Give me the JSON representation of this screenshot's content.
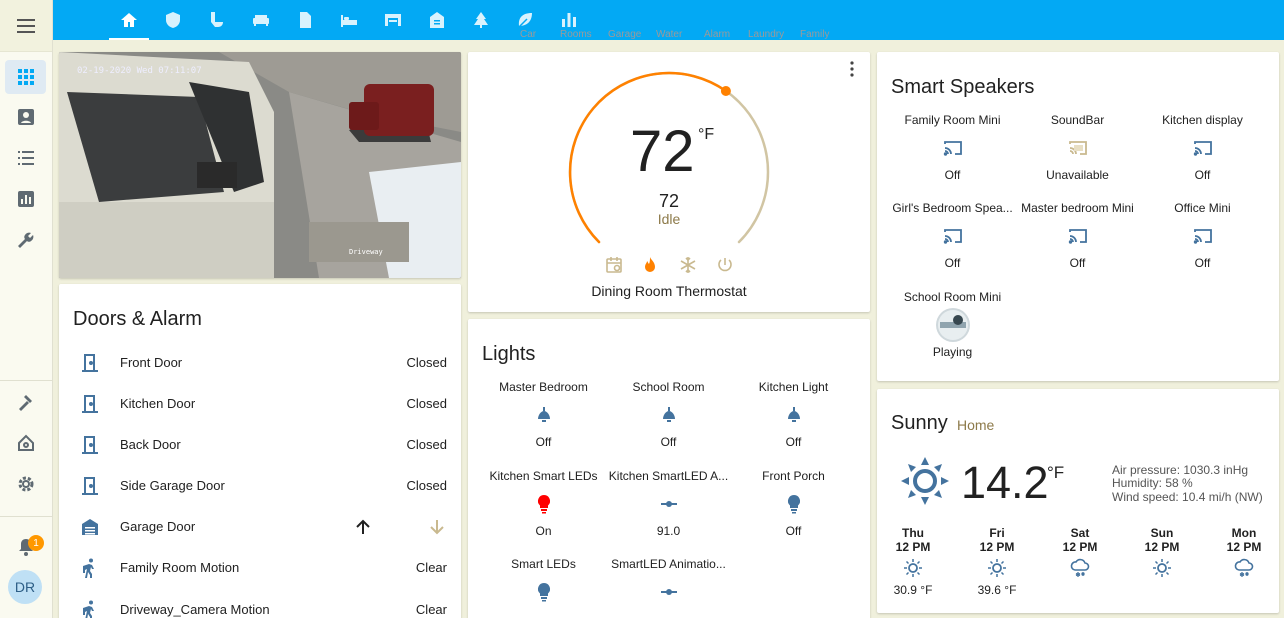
{
  "sidebar": {
    "badge_count": "1",
    "user_initials": "DR"
  },
  "topbar": {
    "ghost_tabs": [
      "Car",
      "Rooms",
      "Garage",
      "Water",
      "Alarm",
      "Laundry",
      "Family"
    ]
  },
  "camera": {
    "timestamp": "02-19-2020 Wed 07:11:07",
    "watermark": "Driveway"
  },
  "doors": {
    "title": "Doors & Alarm",
    "rows": [
      {
        "name": "Front Door",
        "state": "Closed"
      },
      {
        "name": "Kitchen Door",
        "state": "Closed"
      },
      {
        "name": "Back Door",
        "state": "Closed"
      },
      {
        "name": "Side Garage Door",
        "state": "Closed"
      },
      {
        "name": "Garage Door",
        "state": ""
      },
      {
        "name": "Family Room Motion",
        "state": "Clear"
      },
      {
        "name": "Driveway_Camera Motion",
        "state": "Clear"
      }
    ]
  },
  "thermostat": {
    "target": "72",
    "unit": "°F",
    "current": "72",
    "status": "Idle",
    "name": "Dining Room Thermostat",
    "target_fraction": 0.63
  },
  "lights": {
    "title": "Lights",
    "tiles": [
      {
        "name": "Master Bedroom",
        "state": "Off"
      },
      {
        "name": "School Room",
        "state": "Off"
      },
      {
        "name": "Kitchen Light",
        "state": "Off"
      },
      {
        "name": "Kitchen Smart LEDs",
        "state": "On"
      },
      {
        "name": "Kitchen SmartLED A...",
        "state": "91.0"
      },
      {
        "name": "Front Porch",
        "state": "Off"
      },
      {
        "name": "Smart LEDs",
        "state": ""
      },
      {
        "name": "SmartLED Animatio...",
        "state": ""
      }
    ]
  },
  "speakers": {
    "title": "Smart Speakers",
    "tiles": [
      {
        "name": "Family Room Mini",
        "state": "Off"
      },
      {
        "name": "SoundBar",
        "state": "Unavailable"
      },
      {
        "name": "Kitchen display",
        "state": "Off"
      },
      {
        "name": "Girl's Bedroom Spea...",
        "state": "Off"
      },
      {
        "name": "Master bedroom Mini",
        "state": "Off"
      },
      {
        "name": "Office Mini",
        "state": "Off"
      },
      {
        "name": "School Room Mini",
        "state": "Playing"
      }
    ]
  },
  "weather": {
    "condition": "Sunny",
    "location": "Home",
    "temp": "14.2",
    "unit": "°F",
    "pressure": "Air pressure: 1030.3 inHg",
    "humidity": "Humidity: 58 %",
    "wind": "Wind speed: 10.4 mi/h (NW)",
    "forecast": [
      {
        "day": "Thu",
        "hour": "12 PM",
        "temp": "30.9 °F",
        "icon": "sunny-icon"
      },
      {
        "day": "Fri",
        "hour": "12 PM",
        "temp": "39.6 °F",
        "icon": "sunny-icon"
      },
      {
        "day": "Sat",
        "hour": "12 PM",
        "temp": "",
        "icon": "snowy-icon"
      },
      {
        "day": "Sun",
        "hour": "12 PM",
        "temp": "",
        "icon": "sunny-icon"
      },
      {
        "day": "Mon",
        "hour": "12 PM",
        "temp": "",
        "icon": "snowy-icon"
      }
    ]
  },
  "colors": {
    "primary": "#03a9f4",
    "accent": "#ff9800",
    "icon": "#44739e",
    "heat": "#ff8100",
    "light_on": "#ff0000"
  }
}
